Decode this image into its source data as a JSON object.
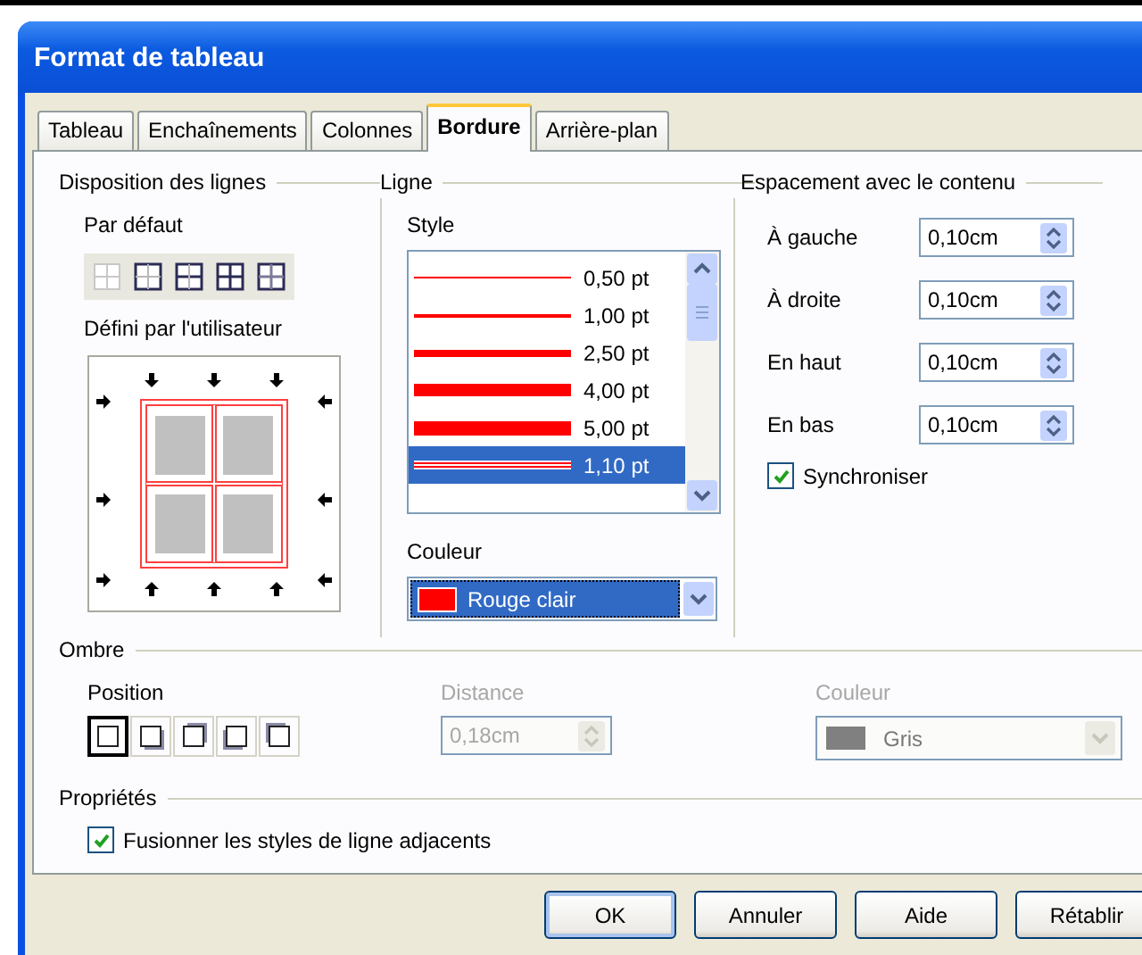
{
  "window": {
    "title": "Format de tableau"
  },
  "tabs": [
    {
      "label": "Tableau",
      "selected": false
    },
    {
      "label": "Enchaînements",
      "selected": false
    },
    {
      "label": "Colonnes",
      "selected": false
    },
    {
      "label": "Bordure",
      "selected": true
    },
    {
      "label": "Arrière-plan",
      "selected": false
    }
  ],
  "line_arrangement": {
    "heading": "Disposition des lignes",
    "default_label": "Par défaut",
    "user_defined_label": "Défini par l'utilisateur"
  },
  "line": {
    "heading": "Ligne",
    "style_label": "Style",
    "styles": [
      {
        "label": "0,50 pt",
        "kind": "hairline",
        "selected": false
      },
      {
        "label": "1,00 pt",
        "kind": "thin",
        "selected": false
      },
      {
        "label": "2,50 pt",
        "kind": "medium",
        "selected": false
      },
      {
        "label": "4,00 pt",
        "kind": "thick",
        "selected": false
      },
      {
        "label": "5,00 pt",
        "kind": "heavy",
        "selected": false
      },
      {
        "label": "1,10 pt",
        "kind": "double",
        "selected": true
      }
    ],
    "color_label": "Couleur",
    "color": {
      "value": "Rouge clair",
      "color": "#ff0000"
    }
  },
  "spacing": {
    "heading": "Espacement avec le contenu",
    "fields": [
      {
        "label": "À gauche",
        "value": "0,10cm"
      },
      {
        "label": "À droite",
        "value": "0,10cm"
      },
      {
        "label": "En haut",
        "value": "0,10cm"
      },
      {
        "label": "En bas",
        "value": "0,10cm"
      }
    ],
    "synchronize": {
      "label": "Synchroniser",
      "checked": true
    }
  },
  "shadow": {
    "heading": "Ombre",
    "position_label": "Position",
    "positions": [
      {
        "kind": "none",
        "selected": true
      },
      {
        "kind": "bottom-right",
        "selected": false
      },
      {
        "kind": "top-right",
        "selected": false
      },
      {
        "kind": "bottom-left",
        "selected": false
      },
      {
        "kind": "top-left",
        "selected": false
      }
    ],
    "distance": {
      "label": "Distance",
      "value": "0,18cm",
      "disabled": true
    },
    "color": {
      "label": "Couleur",
      "value": "Gris",
      "color": "#808080",
      "disabled": true
    }
  },
  "properties": {
    "heading": "Propriétés",
    "merge": {
      "label": "Fusionner les styles de ligne adjacents",
      "checked": true
    }
  },
  "buttons": [
    {
      "label": "OK",
      "default": true
    },
    {
      "label": "Annuler",
      "default": false
    },
    {
      "label": "Aide",
      "default": false
    },
    {
      "label": "Rétablir",
      "default": false
    }
  ]
}
